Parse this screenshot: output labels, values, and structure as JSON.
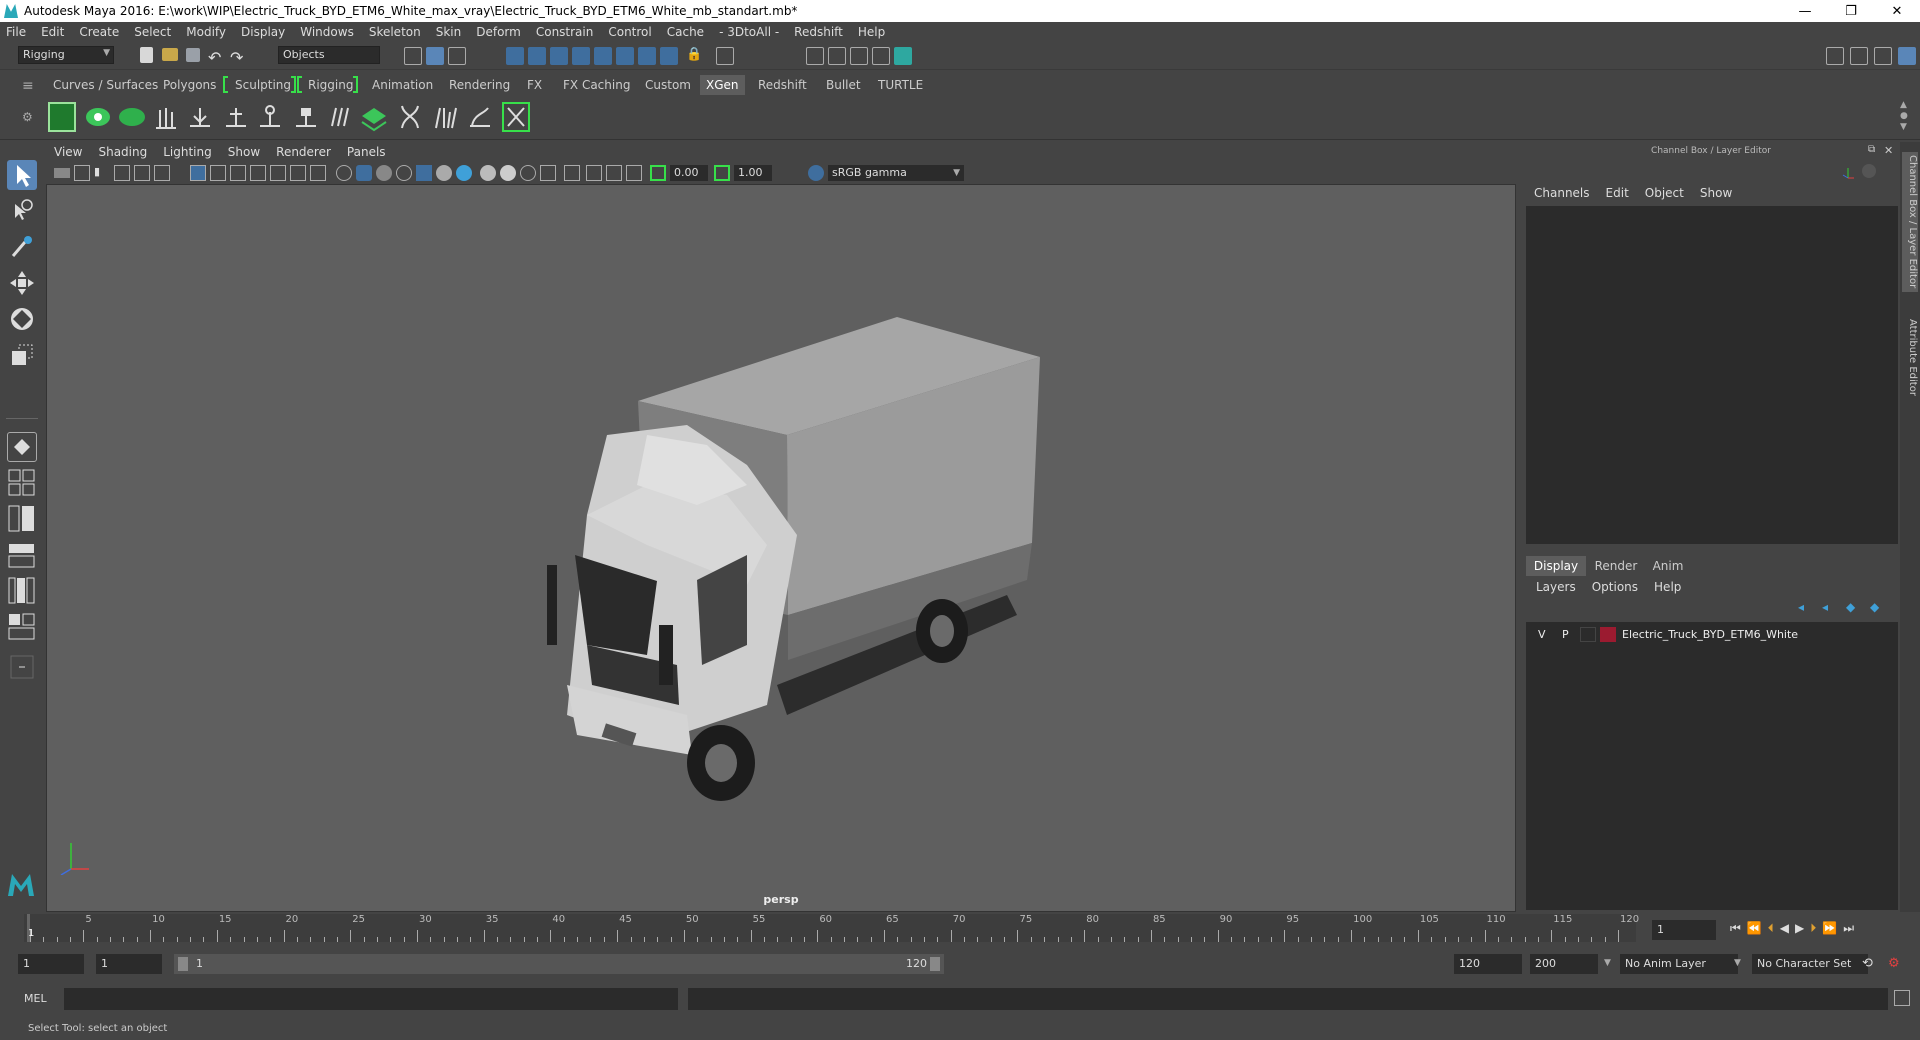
{
  "window": {
    "title": "Autodesk Maya 2016: E:\\work\\WIP\\Electric_Truck_BYD_ETM6_White_max_vray\\Electric_Truck_BYD_ETM6_White_mb_standart.mb*",
    "minimize": "—",
    "restore": "❐",
    "close": "✕"
  },
  "menus": [
    "File",
    "Edit",
    "Create",
    "Select",
    "Modify",
    "Display",
    "Windows",
    "Skeleton",
    "Skin",
    "Deform",
    "Constrain",
    "Control",
    "Cache",
    "- 3DtoAll -",
    "Redshift",
    "Help"
  ],
  "statusline": {
    "mode": "Rigging",
    "selection_mask": "Objects"
  },
  "shelf_tabs": [
    {
      "label": "Curves / Surfaces",
      "active": false
    },
    {
      "label": "Polygons",
      "active": false
    },
    {
      "label": "Sculpting",
      "active": false
    },
    {
      "label": "Rigging",
      "active": false
    },
    {
      "label": "Animation",
      "active": false
    },
    {
      "label": "Rendering",
      "active": false
    },
    {
      "label": "FX",
      "active": false
    },
    {
      "label": "FX Caching",
      "active": false
    },
    {
      "label": "Custom",
      "active": false
    },
    {
      "label": "XGen",
      "active": true
    },
    {
      "label": "Redshift",
      "active": false
    },
    {
      "label": "Bullet",
      "active": false
    },
    {
      "label": "TURTLE",
      "active": false
    }
  ],
  "panel_menus": [
    "View",
    "Shading",
    "Lighting",
    "Show",
    "Renderer",
    "Panels"
  ],
  "viewport": {
    "exposure": "0.00",
    "gamma": "1.00",
    "color_space": "sRGB gamma",
    "camera_label": "persp"
  },
  "channel_box": {
    "title": "Channel Box / Layer Editor",
    "menus": [
      "Channels",
      "Edit",
      "Object",
      "Show"
    ]
  },
  "layer_editor": {
    "tabs": [
      {
        "label": "Display",
        "active": true
      },
      {
        "label": "Render",
        "active": false
      },
      {
        "label": "Anim",
        "active": false
      }
    ],
    "menus": [
      "Layers",
      "Options",
      "Help"
    ],
    "layers": [
      {
        "visible": "V",
        "playback": "P",
        "color": "#9b1b30",
        "name": "Electric_Truck_BYD_ETM6_White"
      }
    ]
  },
  "side_tabs": [
    "Channel Box / Layer Editor",
    "Attribute Editor"
  ],
  "timeline": {
    "ticks": [
      1,
      5,
      10,
      15,
      20,
      25,
      30,
      35,
      40,
      45,
      50,
      55,
      60,
      65,
      70,
      75,
      80,
      85,
      90,
      95,
      100,
      105,
      110,
      115,
      120
    ],
    "current_frame_label": "1",
    "current_frame_field": "1"
  },
  "range": {
    "start_field": "1",
    "playback_start": "1",
    "slider_start": "1",
    "slider_end": "120",
    "playback_end": "120",
    "end_field": "200",
    "anim_layer": "No Anim Layer",
    "character_set": "No Character Set"
  },
  "command_line": {
    "lang": "MEL"
  },
  "help_line": "Select Tool: select an object"
}
